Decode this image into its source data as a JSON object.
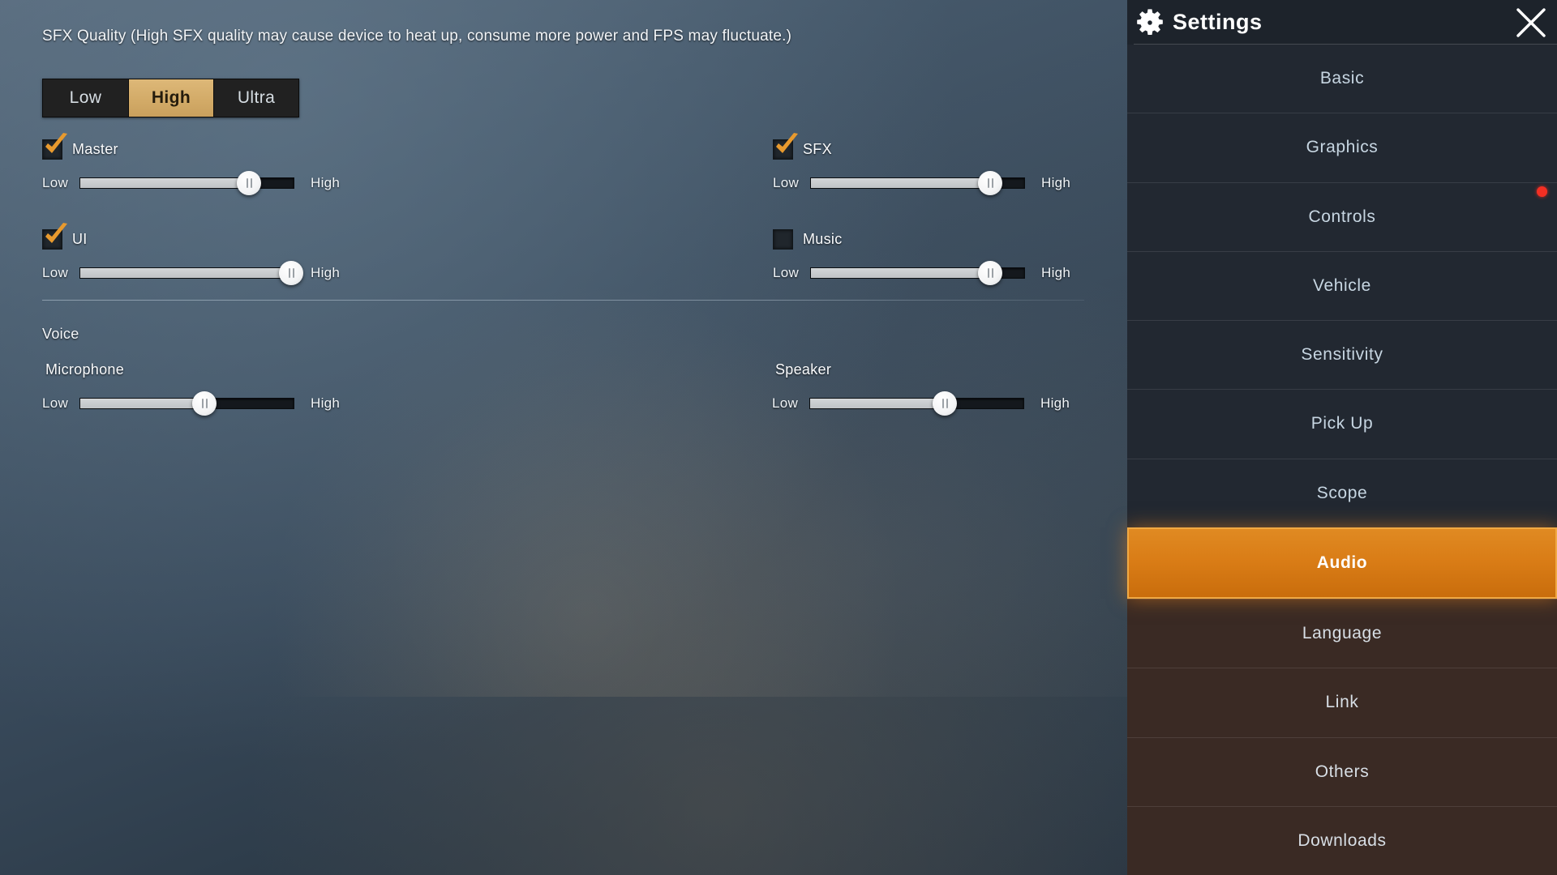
{
  "quality": {
    "description": "SFX Quality (High SFX quality may cause device to heat up, consume more power and FPS may fluctuate.)",
    "options": [
      {
        "label": "Low",
        "selected": false
      },
      {
        "label": "High",
        "selected": true
      },
      {
        "label": "Ultra",
        "selected": false
      }
    ]
  },
  "slider_labels": {
    "low": "Low",
    "high": "High"
  },
  "channels": [
    {
      "name": "Master",
      "checked": true,
      "value": 79
    },
    {
      "name": "SFX",
      "checked": true,
      "value": 84
    },
    {
      "name": "UI",
      "checked": true,
      "value": 99
    },
    {
      "name": "Music",
      "checked": false,
      "value": 84
    }
  ],
  "voice": {
    "title": "Voice",
    "items": [
      {
        "name": "Microphone",
        "value": 58
      },
      {
        "name": "Speaker",
        "value": 63
      }
    ]
  },
  "sidebar": {
    "title": "Settings",
    "gear_icon": "gear-icon",
    "close_icon": "close-icon",
    "items": [
      {
        "label": "Basic",
        "active": false,
        "badge": false
      },
      {
        "label": "Graphics",
        "active": false,
        "badge": false
      },
      {
        "label": "Controls",
        "active": false,
        "badge": true
      },
      {
        "label": "Vehicle",
        "active": false,
        "badge": false
      },
      {
        "label": "Sensitivity",
        "active": false,
        "badge": false
      },
      {
        "label": "Pick Up",
        "active": false,
        "badge": false
      },
      {
        "label": "Scope",
        "active": false,
        "badge": false
      },
      {
        "label": "Audio",
        "active": true,
        "badge": false
      },
      {
        "label": "Language",
        "active": false,
        "badge": false
      },
      {
        "label": "Link",
        "active": false,
        "badge": false
      },
      {
        "label": "Others",
        "active": false,
        "badge": false
      },
      {
        "label": "Downloads",
        "active": false,
        "badge": false
      }
    ]
  },
  "colors": {
    "accent_orange": "#d97c16",
    "accent_gold": "#d3ab68",
    "badge_red": "#f42f23",
    "panel_dark": "#222831"
  }
}
